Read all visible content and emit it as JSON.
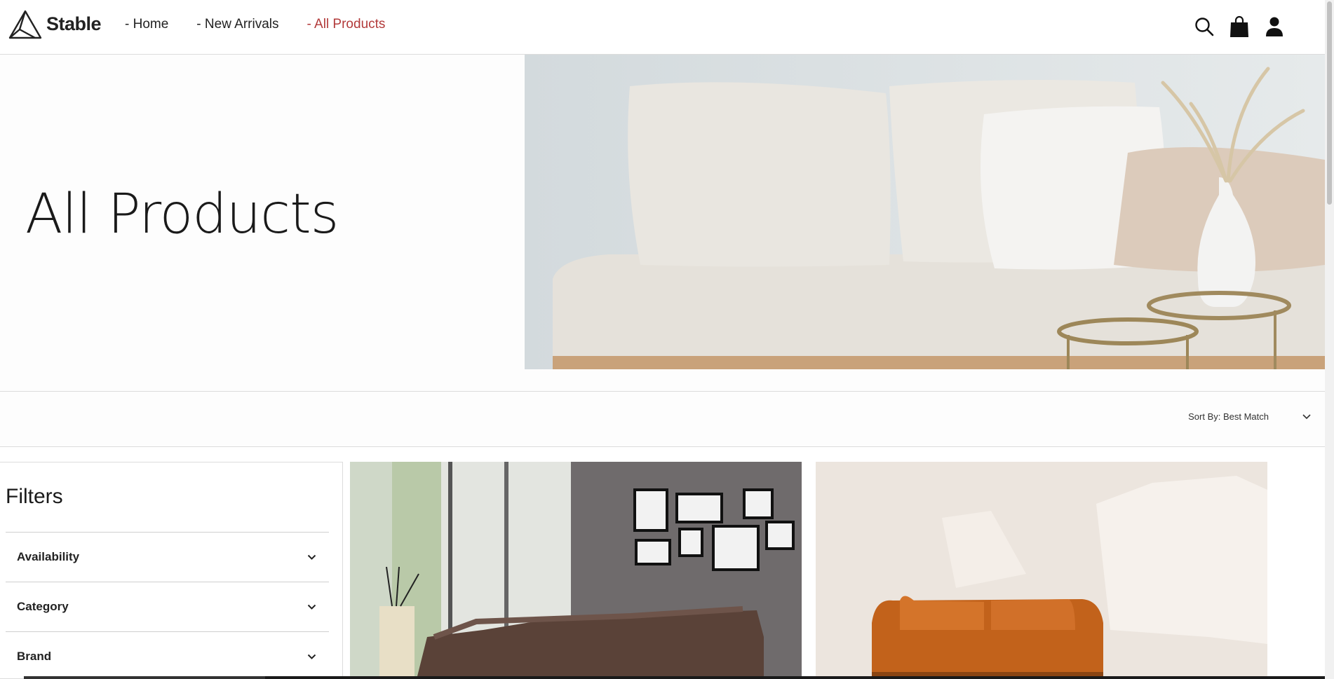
{
  "brand": {
    "name": "Stable"
  },
  "nav": {
    "items": [
      {
        "label": "- Home",
        "active": false
      },
      {
        "label": "- New Arrivals",
        "active": false
      },
      {
        "label": "- All Products",
        "active": true
      }
    ]
  },
  "header_icons": [
    "search-icon",
    "shopping-bag-icon",
    "user-icon"
  ],
  "hero": {
    "title": "All Products"
  },
  "toolbar": {
    "sort_label": "Sort By: Best Match"
  },
  "filters": {
    "title": "Filters",
    "items": [
      {
        "label": "Availability"
      },
      {
        "label": "Category"
      },
      {
        "label": "Brand"
      }
    ]
  },
  "colors": {
    "accent": "#b23a3a",
    "text": "#1a1a1a",
    "border": "#dcdcdc"
  }
}
